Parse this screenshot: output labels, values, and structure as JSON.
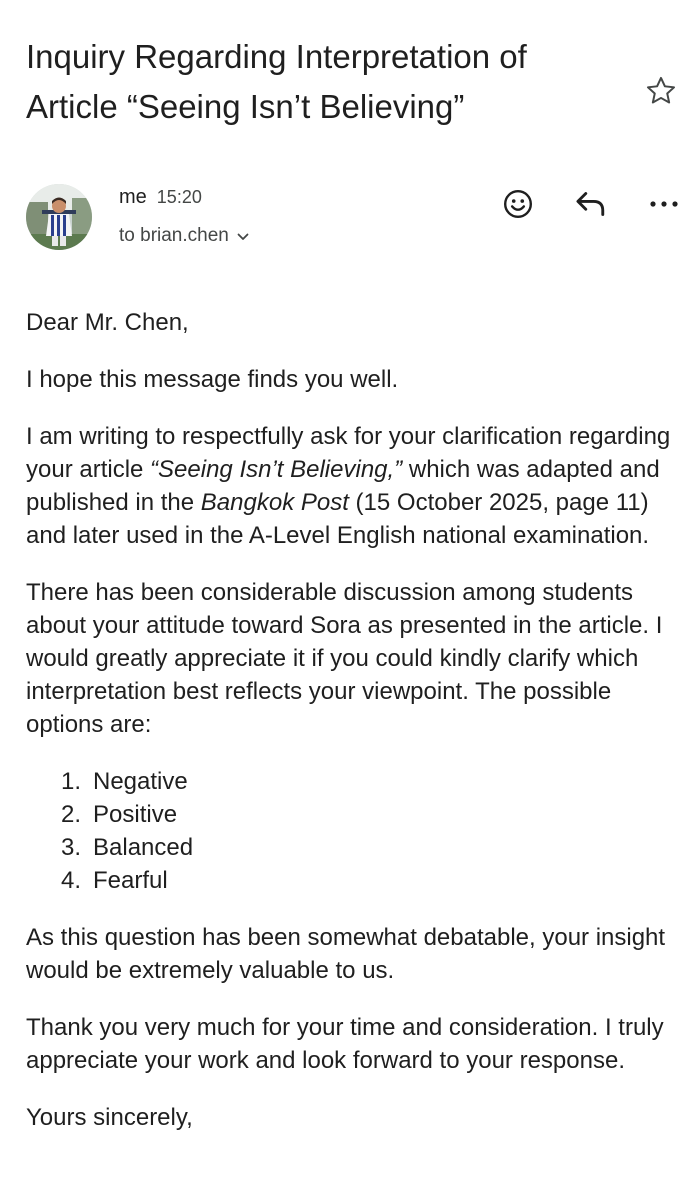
{
  "email": {
    "subject_line1": "Inquiry Regarding Interpretation of",
    "subject_line2": "Article “Seeing Isn’t Believing”",
    "sender": {
      "name": "me",
      "time": "15:20",
      "recipient": "to brian.chen"
    },
    "icons": {
      "star": "star-icon",
      "emoji": "emoji-react-icon",
      "reply": "reply-icon",
      "more": "more-horizontal-icon",
      "recipient_toggle": "chevron-down-icon"
    },
    "body": {
      "greeting": "Dear Mr. Chen,",
      "p1": "I hope this message finds you well.",
      "p2_prefix": "I am writing to respectfully ask for your clarification regarding your article ",
      "p2_article": "“Seeing Isn’t Believing,”",
      "p2_middle": " which was adapted and published in the ",
      "p2_paper": "Bangkok Post",
      "p2_suffix": " (15 October 2025, page 11) and later used in the A-Level English national examination.",
      "p3": "There has been considerable discussion among students about your attitude toward Sora as presented in the article. I would greatly appreciate it if you could kindly clarify which interpretation best reflects your viewpoint. The possible options are:",
      "options": [
        {
          "num": "1.",
          "label": "Negative"
        },
        {
          "num": "2.",
          "label": "Positive"
        },
        {
          "num": "3.",
          "label": "Balanced"
        },
        {
          "num": "4.",
          "label": "Fearful"
        }
      ],
      "p4": "As this question has been somewhat debatable, your insight would be extremely valuable to us.",
      "p5": "Thank you very much for your time and consideration. I truly appreciate your work and look forward to your response.",
      "closing": "Yours sincerely,"
    }
  },
  "colors": {
    "text": "#1f1f1f",
    "secondary_text": "#444746",
    "background": "#ffffff"
  }
}
